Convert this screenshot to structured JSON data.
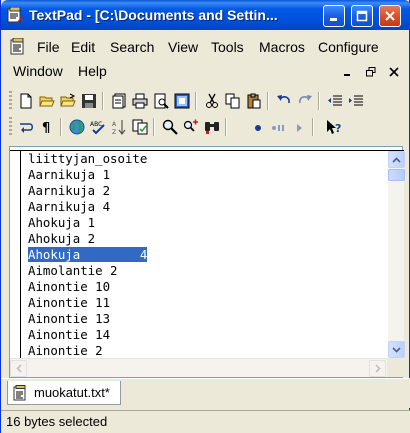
{
  "window": {
    "title": "TextPad - [C:\\Documents and Settin..."
  },
  "menu": {
    "items": [
      "File",
      "Edit",
      "Search",
      "View",
      "Tools",
      "Macros",
      "Configure"
    ],
    "items_row2": [
      "Window",
      "Help"
    ]
  },
  "toolbar1": {
    "icons": [
      "new-icon",
      "open-icon",
      "open-folder-icon",
      "save-icon",
      "save-all-icon",
      "print-icon",
      "print-preview-icon",
      "spell-doc-icon",
      "cut-icon",
      "copy-icon",
      "paste-icon",
      "undo-icon",
      "redo-icon",
      "outdent-icon",
      "indent-icon"
    ]
  },
  "toolbar2": {
    "icons": [
      "word-wrap-icon",
      "show-paragraph-icon",
      "web-icon",
      "spelling-icon",
      "sort-icon",
      "compare-icon",
      "find-icon",
      "find-next-icon",
      "find-in-files-icon",
      "record-macro-icon",
      "pause-macro-icon",
      "play-macro-icon",
      "help-icon"
    ]
  },
  "editor": {
    "lines": [
      "liittyjan_osoite",
      "Aarnikuja 1",
      "Aarnikuja 2",
      "Aarnikuja 4",
      "Ahokuja 1",
      "Ahokuja 2",
      "Ahokuja\t4",
      "Aimolantie 2",
      "Ainontie 10",
      "Ainontie 11",
      "Ainontie 13",
      "Ainontie 14",
      "Ainontie 2"
    ],
    "selected_line_index": 6,
    "selected_text": "Ahokuja        4"
  },
  "tabs": [
    {
      "label": "muokatut.txt*"
    }
  ],
  "status": {
    "text": "16 bytes selected"
  },
  "colors": {
    "titlebar": "#0058e6",
    "selection": "#316ac5"
  }
}
